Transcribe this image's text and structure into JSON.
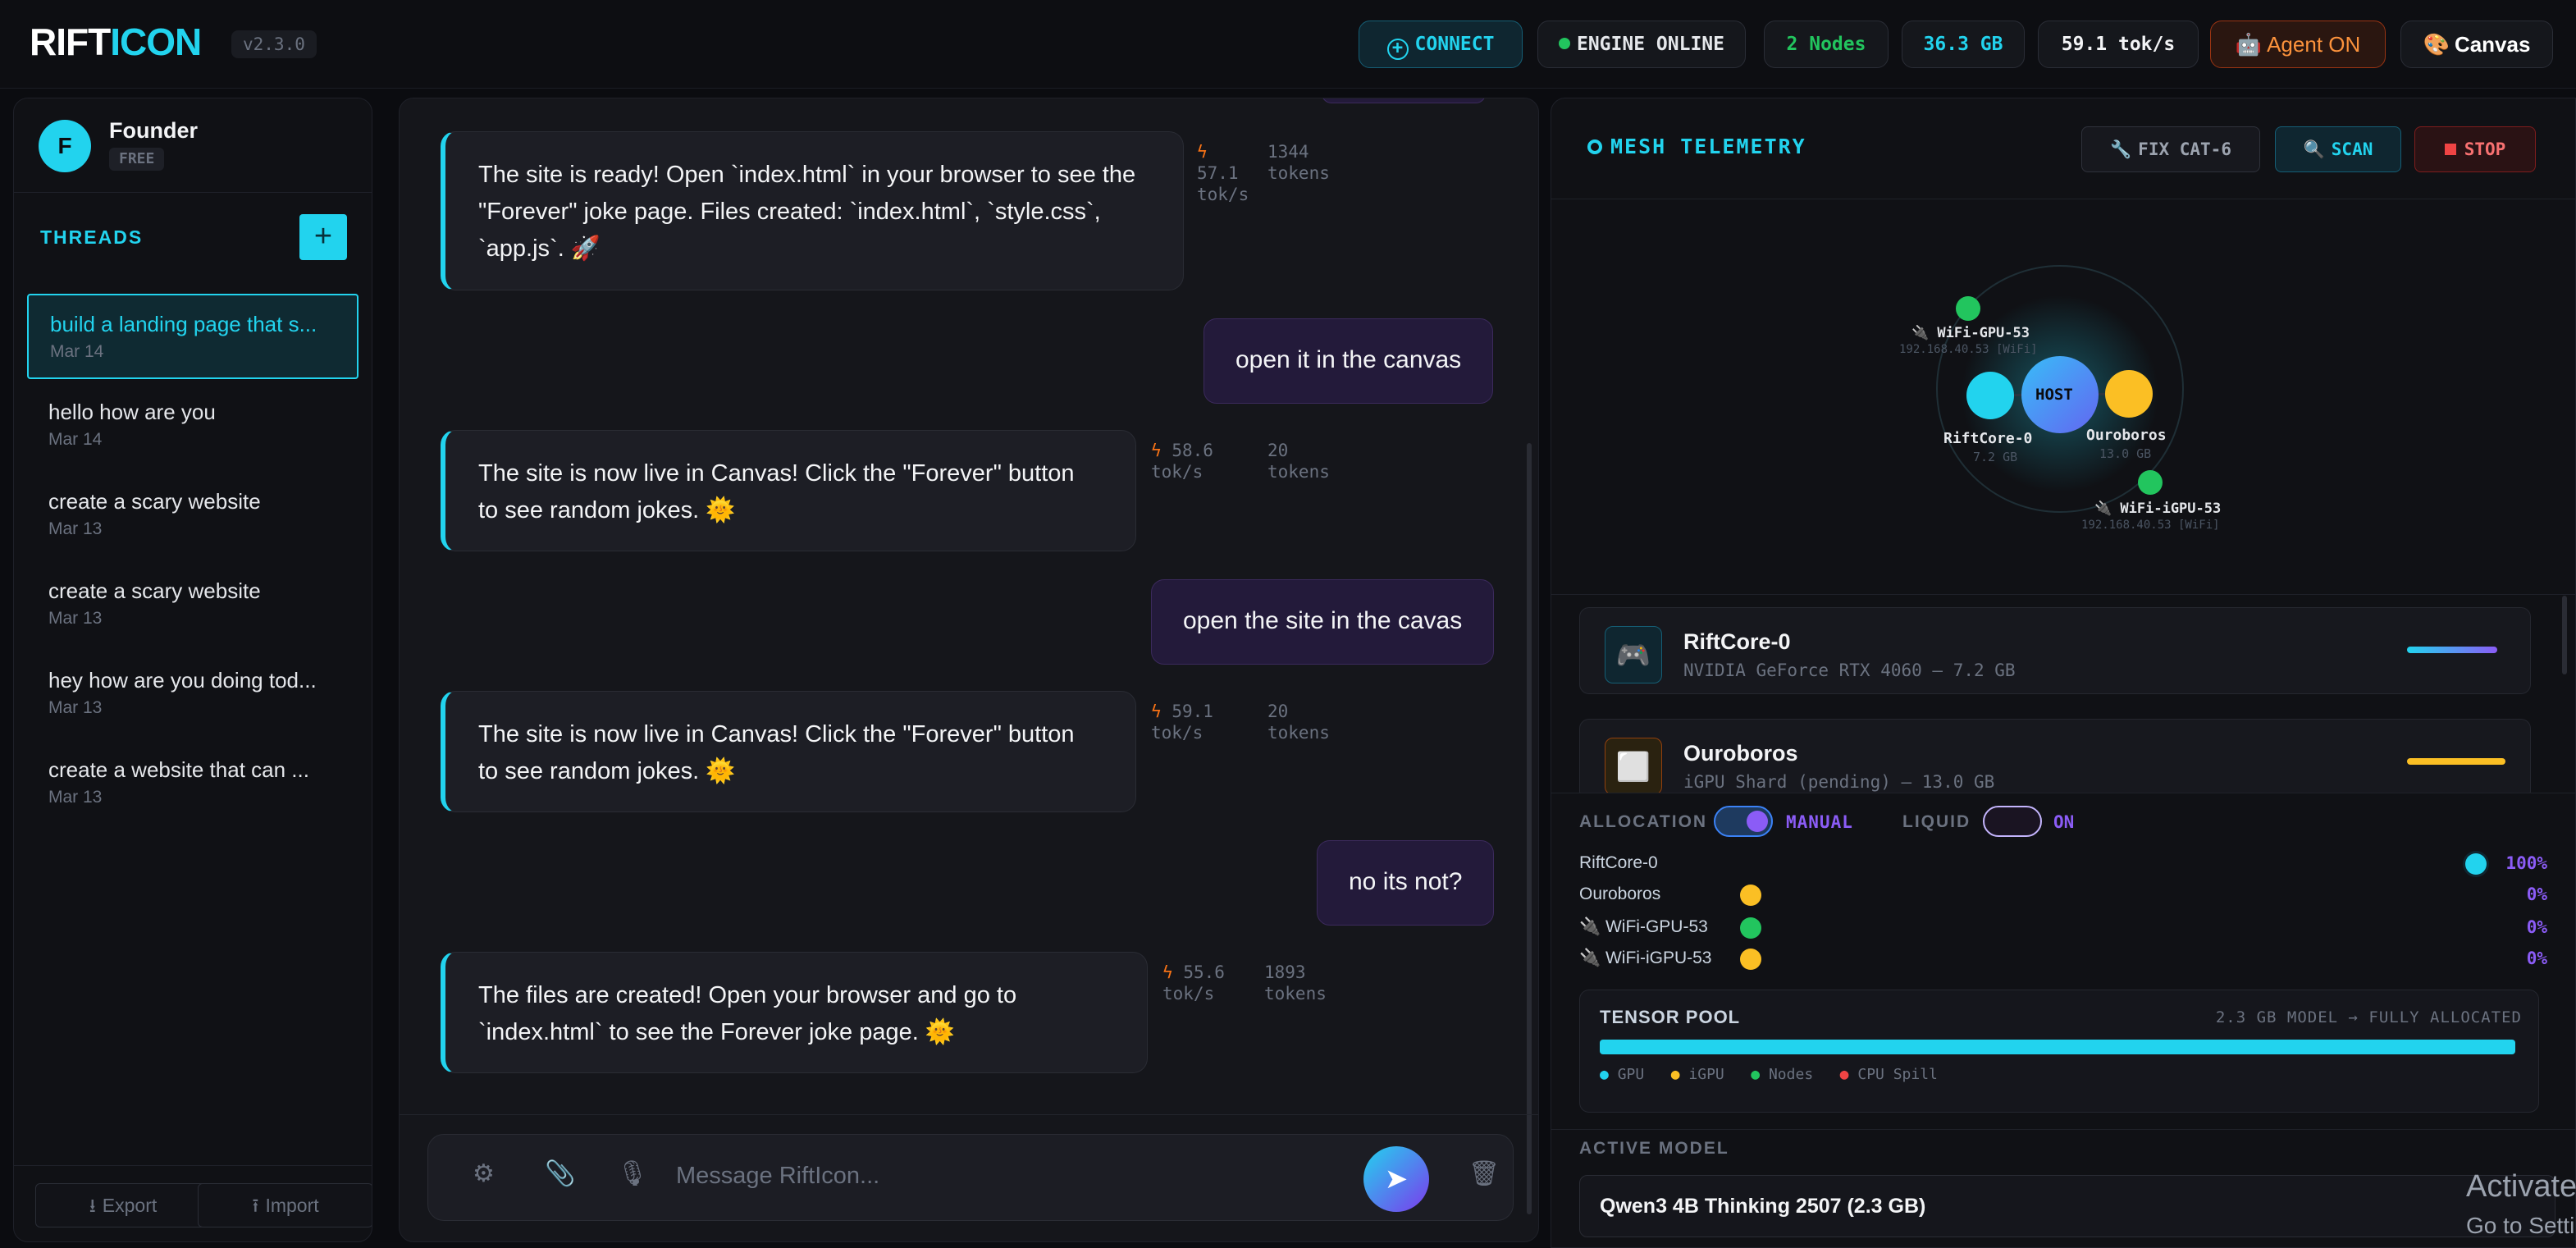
{
  "header": {
    "logo_part1": "RIFT",
    "logo_part2": "ICON",
    "version": "v2.3.0",
    "connect_label": "CONNECT",
    "engine_status": "ENGINE ONLINE",
    "nodes": "2 Nodes",
    "memory": "36.3 GB",
    "speed": "59.1 tok/s",
    "agent_label": "Agent ON",
    "canvas_label": "Canvas"
  },
  "user": {
    "initial": "F",
    "name": "Founder",
    "plan": "FREE"
  },
  "sidebar": {
    "threads_title": "THREADS",
    "add_label": "+",
    "threads": [
      {
        "title": "build a landing page that s...",
        "date": "Mar 14"
      },
      {
        "title": "hello how are you",
        "date": "Mar 14"
      },
      {
        "title": "create a scary website",
        "date": "Mar 13"
      },
      {
        "title": "create a scary website",
        "date": "Mar 13"
      },
      {
        "title": "hey how are you doing tod...",
        "date": "Mar 13"
      },
      {
        "title": "create a website that can ...",
        "date": "Mar 13"
      }
    ],
    "export_label": "Export",
    "import_label": "Import"
  },
  "chat": {
    "messages": [
      {
        "role": "ai",
        "lines": [
          "The site is ready! Open `index.html` in your browser to see the",
          "\"Forever\" joke page. Files created: `index.html`, `style.css`,",
          "`app.js`. 🚀"
        ],
        "speed": "57.1",
        "speed_unit": "tok/s",
        "tokens": "1344",
        "tokens_unit": "tokens"
      },
      {
        "role": "user",
        "text": "open it in the canvas"
      },
      {
        "role": "ai",
        "lines": [
          "The site is now live in Canvas! Click the \"Forever\" button",
          "to see random jokes. 🌞"
        ],
        "speed": "58.6",
        "speed_unit": "tok/s",
        "tokens": "20",
        "tokens_unit": "tokens"
      },
      {
        "role": "user",
        "text": "open the site in the cavas"
      },
      {
        "role": "ai",
        "lines": [
          "The site is now live in Canvas! Click the \"Forever\" button",
          "to see random jokes. 🌞"
        ],
        "speed": "59.1",
        "speed_unit": "tok/s",
        "tokens": "20",
        "tokens_unit": "tokens"
      },
      {
        "role": "user",
        "text": "no its not?"
      },
      {
        "role": "ai",
        "lines": [
          "The files are created! Open your browser and go to",
          "`index.html` to see the Forever joke page. 🌞"
        ],
        "speed": "55.6",
        "speed_unit": "tok/s",
        "tokens": "1893",
        "tokens_unit": "tokens"
      }
    ],
    "placeholder": "Message RiftIcon..."
  },
  "telemetry": {
    "title": "MESH TELEMETRY",
    "fix_label": "FIX CAT-6",
    "scan_label": "SCAN",
    "stop_label": "STOP",
    "graph": {
      "host": "HOST",
      "nodes": [
        {
          "name": "WiFi-GPU-53",
          "sub": "192.168.40.53 [WiFi]"
        },
        {
          "name": "RiftCore-0",
          "sub": "7.2 GB"
        },
        {
          "name": "Ouroboros",
          "sub": "13.0 GB"
        },
        {
          "name": "WiFi-iGPU-53",
          "sub": "192.168.40.53 [WiFi]"
        }
      ]
    },
    "cards": [
      {
        "name": "RiftCore-0",
        "sub": "NVIDIA GeForce RTX 4060 — 7.2 GB",
        "icon": "gamepad-icon"
      },
      {
        "name": "Ouroboros",
        "sub": "iGPU Shard (pending) — 13.0 GB",
        "icon": "chip-icon"
      }
    ],
    "allocation": {
      "label": "ALLOCATION",
      "mode": "MANUAL",
      "liquid_label": "LIQUID",
      "liquid_state": "ON",
      "rows": [
        {
          "name": "RiftCore-0",
          "pct": "100%",
          "color": "#22d3ee"
        },
        {
          "name": "Ouroboros",
          "pct": "0%",
          "color": "#fbbf24"
        },
        {
          "name": "WiFi-GPU-53",
          "pct": "0%",
          "color": "#22c55e"
        },
        {
          "name": "WiFi-iGPU-53",
          "pct": "0%",
          "color": "#fbbf24"
        }
      ]
    },
    "pool": {
      "title": "TENSOR POOL",
      "status": "2.3 GB MODEL → FULLY ALLOCATED",
      "fill": 1.0,
      "legend": [
        "GPU",
        "iGPU",
        "Nodes",
        "CPU Spill"
      ]
    },
    "active_model_label": "ACTIVE MODEL",
    "active_model": "Qwen3 4B Thinking 2507 (2.3 GB)"
  },
  "watermark": {
    "line1": "Activate",
    "line2": "Go to Setti"
  },
  "colors": {
    "accent": "#22d3ee",
    "purple": "#8b5cf6",
    "orange": "#fbbf24",
    "green": "#22c55e",
    "red": "#ef4444"
  }
}
